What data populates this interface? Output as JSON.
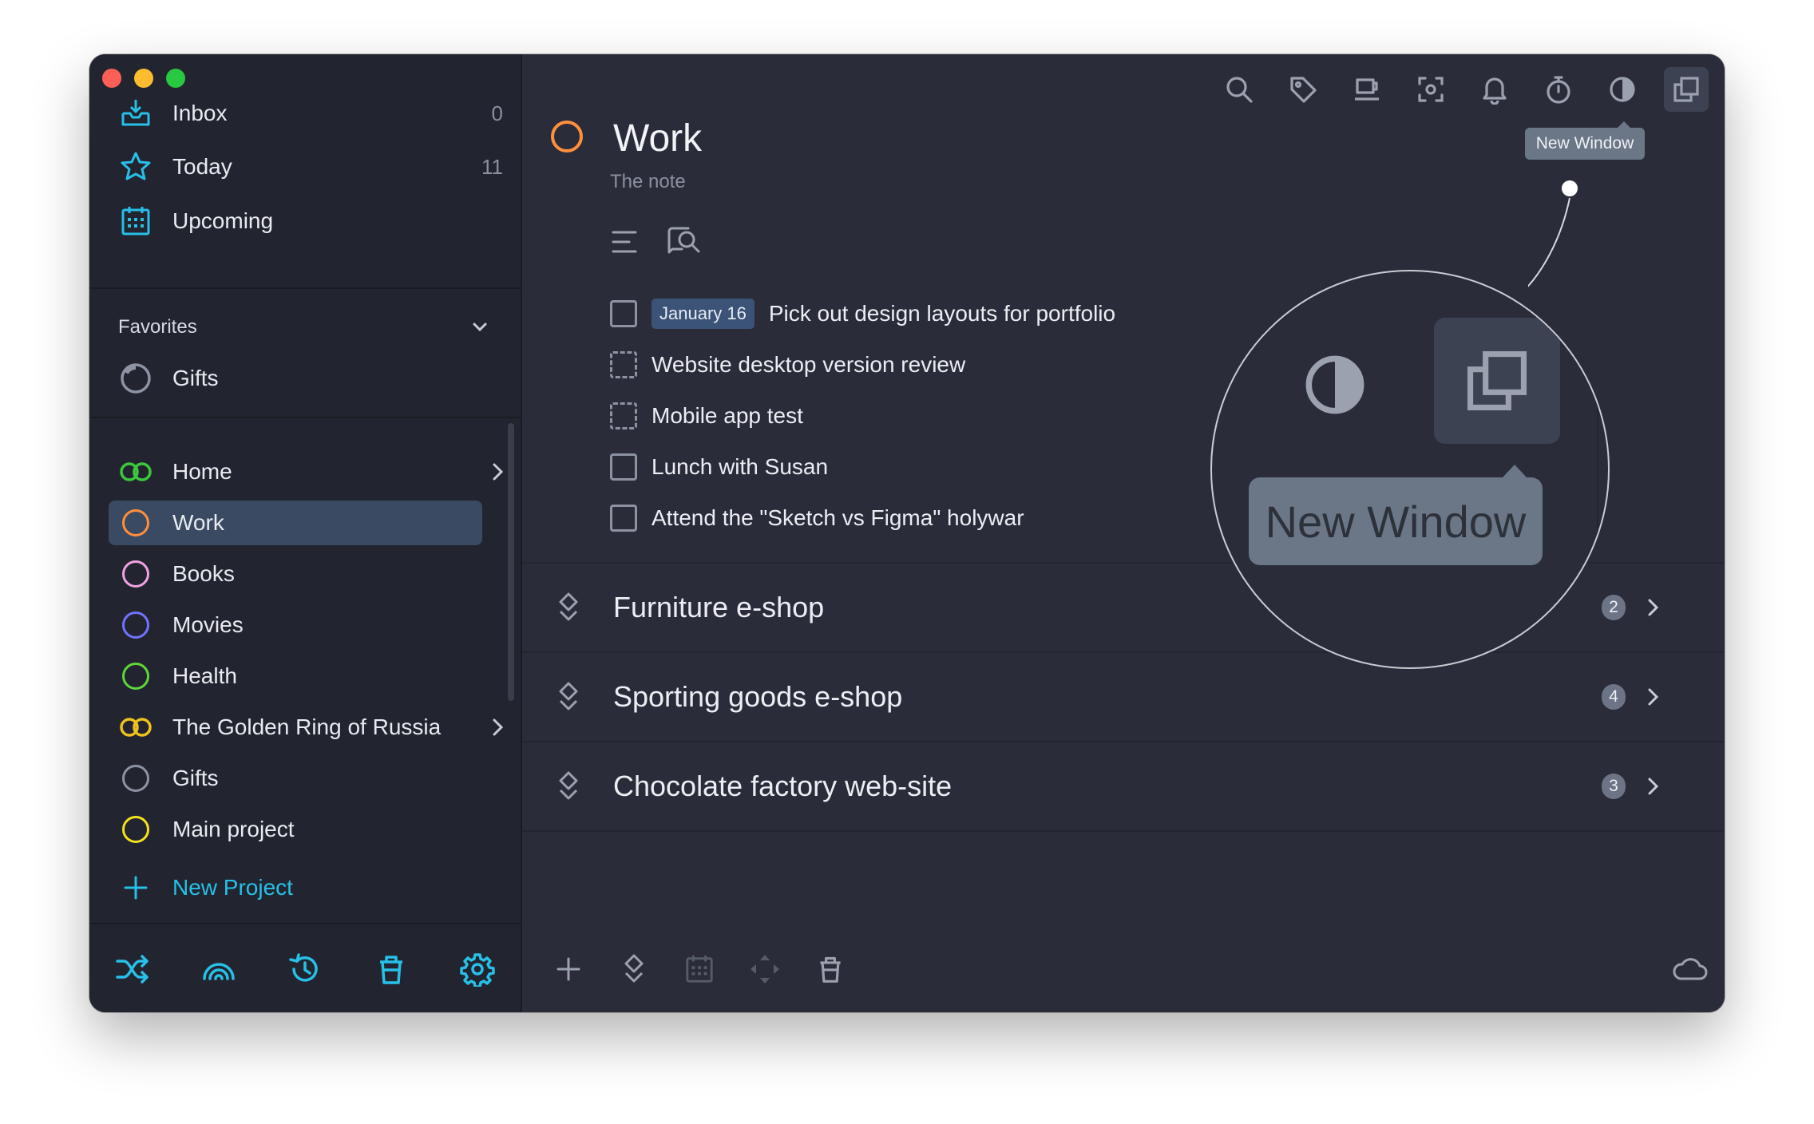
{
  "window": {
    "traffic_lights": [
      "close",
      "minimize",
      "zoom"
    ]
  },
  "sidebar": {
    "nav": [
      {
        "label": "Inbox",
        "count": "0",
        "icon": "inbox-icon"
      },
      {
        "label": "Today",
        "count": "11",
        "icon": "star-icon"
      },
      {
        "label": "Upcoming",
        "count": "",
        "icon": "calendar-icon"
      }
    ],
    "favorites_title": "Favorites",
    "favorites": [
      {
        "label": "Gifts",
        "icon": "progress-ring-icon"
      }
    ],
    "projects": [
      {
        "label": "Home",
        "color": "#3cc83c",
        "type": "group"
      },
      {
        "label": "Work",
        "color": "#ff8f3c",
        "type": "ring",
        "active": true
      },
      {
        "label": "Books",
        "color": "#f0a3e3",
        "type": "ring"
      },
      {
        "label": "Movies",
        "color": "#6f73ff",
        "type": "ring"
      },
      {
        "label": "Health",
        "color": "#5fd63a",
        "type": "ring"
      },
      {
        "label": "The Golden Ring of Russia",
        "color": "#f0c21c",
        "type": "group"
      },
      {
        "label": "Gifts",
        "color": "#8e93a3",
        "type": "ring"
      },
      {
        "label": "Main project",
        "color": "#f3e21b",
        "type": "ring"
      }
    ],
    "new_project_label": "New Project",
    "accent": "#27c0e8",
    "bottom_icons": [
      "shuffle-icon",
      "rainbow-icon",
      "history-icon",
      "trash-icon",
      "settings-icon"
    ]
  },
  "toolbar": {
    "icons": [
      "search-icon",
      "tag-icon",
      "coffee-icon",
      "focus-icon",
      "bell-icon",
      "timer-icon",
      "contrast-icon",
      "new-window-icon"
    ],
    "tooltip": "New Window"
  },
  "project": {
    "title": "Work",
    "note": "The note",
    "ring_color": "#ff8f3c"
  },
  "tasks": [
    {
      "date": "January 16",
      "text": "Pick out design layouts for portfolio",
      "dashed": false
    },
    {
      "date": "",
      "text": "Website desktop version review",
      "dashed": true
    },
    {
      "date": "",
      "text": "Mobile app test",
      "dashed": true
    },
    {
      "date": "",
      "text": "Lunch with Susan",
      "dashed": false
    },
    {
      "date": "",
      "text": "Attend the \"Sketch vs Figma\" holywar",
      "dashed": false
    }
  ],
  "sub_projects": [
    {
      "title": "Furniture e-shop",
      "count": "2"
    },
    {
      "title": "Sporting goods e-shop",
      "count": "4"
    },
    {
      "title": "Chocolate factory web-site",
      "count": "3"
    }
  ],
  "magnifier": {
    "tooltip": "New Window"
  },
  "bottom_main_icons": [
    "add-icon",
    "subproject-icon",
    "calendar-icon",
    "move-icon",
    "trash-icon",
    "cloud-icon"
  ]
}
